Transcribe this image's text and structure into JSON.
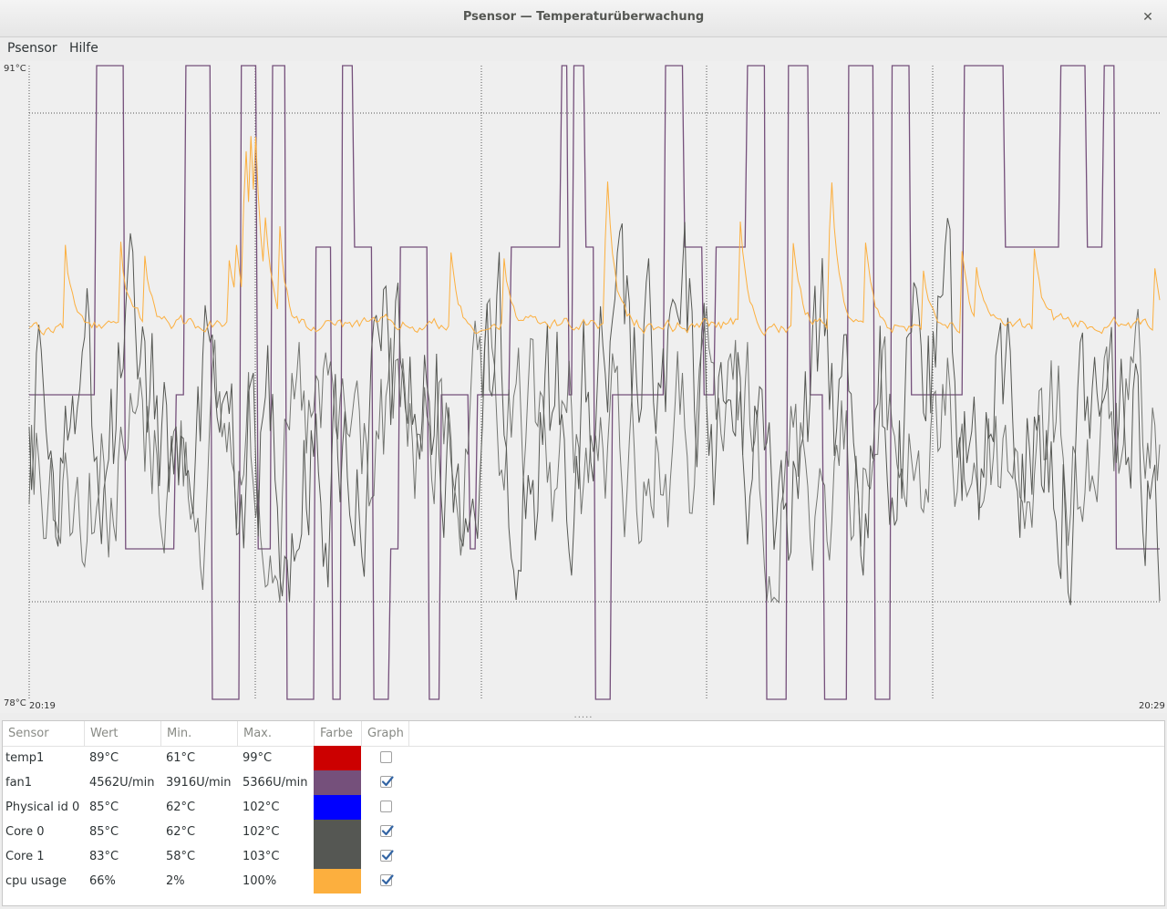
{
  "window": {
    "title": "Psensor — Temperaturüberwachung",
    "close_icon": "close-icon"
  },
  "menu": {
    "items": [
      "Psensor",
      "Hilfe"
    ]
  },
  "graph": {
    "y_max_label": "91°C",
    "y_min_label": "78°C",
    "x_start_label": "20:19",
    "x_end_label": "20:29",
    "handle_label": "....."
  },
  "chart_data": {
    "type": "line",
    "ylim": [
      78,
      91
    ],
    "y_unit": "°C",
    "x_range": [
      "20:19",
      "20:29"
    ],
    "grid": true,
    "series": [
      {
        "name": "fan1",
        "color": "#75507b"
      },
      {
        "name": "Core 0",
        "color": "#555753"
      },
      {
        "name": "Core 1",
        "color": "#555753"
      },
      {
        "name": "cpu usage",
        "color": "#fcaf3e"
      }
    ]
  },
  "table": {
    "headers": [
      "Sensor",
      "Wert",
      "Min.",
      "Max.",
      "Farbe",
      "Graph"
    ],
    "rows": [
      {
        "sensor": "temp1",
        "wert": "89°C",
        "min": "61°C",
        "max": "99°C",
        "color": "#cc0000",
        "graph": false
      },
      {
        "sensor": "fan1",
        "wert": "4562U/min",
        "min": "3916U/min",
        "max": "5366U/min",
        "color": "#75507b",
        "graph": true
      },
      {
        "sensor": "Physical id 0",
        "wert": "85°C",
        "min": "62°C",
        "max": "102°C",
        "color": "#0000ff",
        "graph": false
      },
      {
        "sensor": "Core 0",
        "wert": "85°C",
        "min": "62°C",
        "max": "102°C",
        "color": "#555753",
        "graph": true
      },
      {
        "sensor": "Core 1",
        "wert": "83°C",
        "min": "58°C",
        "max": "103°C",
        "color": "#555753",
        "graph": true
      },
      {
        "sensor": "cpu usage",
        "wert": "66%",
        "min": "2%",
        "max": "100%",
        "color": "#fcaf3e",
        "graph": true
      }
    ]
  }
}
